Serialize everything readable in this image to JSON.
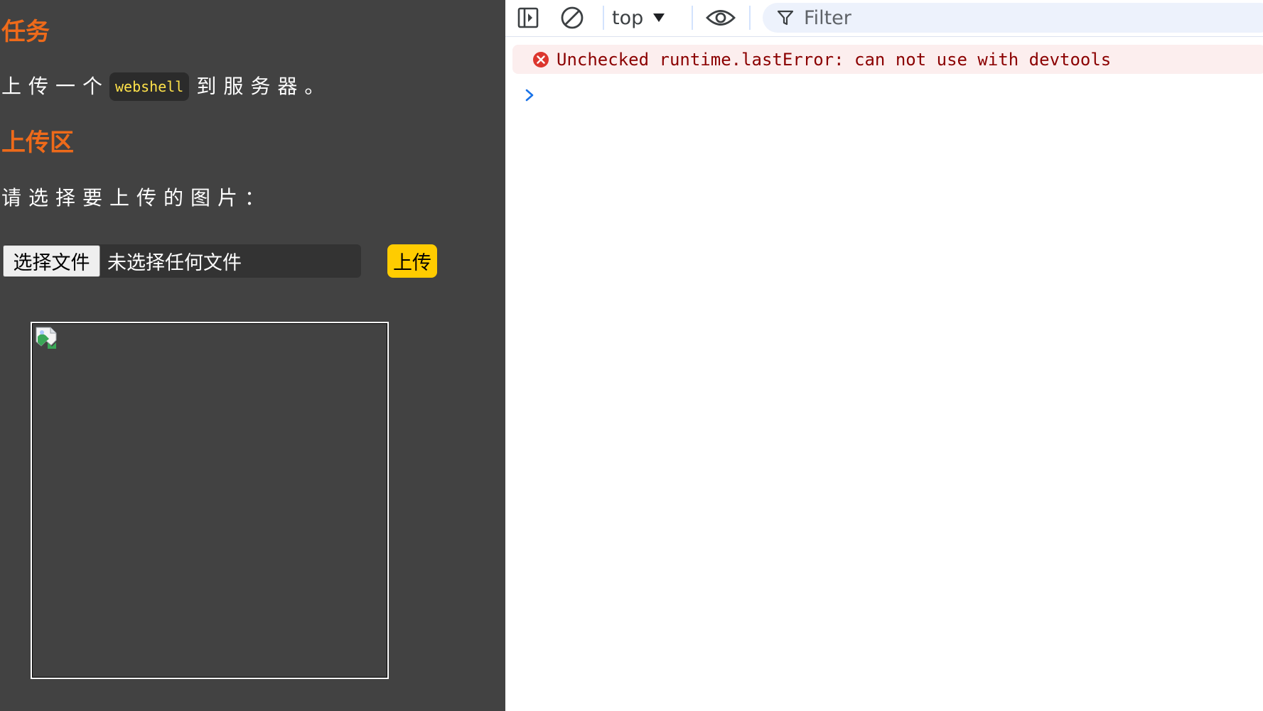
{
  "page": {
    "task_heading": "任务",
    "task_text_before": "上传一个",
    "task_code": "webshell",
    "task_text_after": "到服务器。",
    "upload_heading": "上传区",
    "choose_prompt": "请选择要上传的图片：",
    "file_button_label": "选择文件",
    "file_status": "未选择任何文件",
    "upload_button_label": "上传",
    "broken_image_icon": "broken-image-icon"
  },
  "devtools": {
    "toolbar": {
      "sidebar_icon": "sidebar-toggle-icon",
      "clear_icon": "clear-console-icon",
      "context_label": "top",
      "eye_icon": "live-expression-eye-icon",
      "filter_icon": "filter-funnel-icon",
      "filter_placeholder": "Filter"
    },
    "messages": [
      {
        "level": "error",
        "icon": "error-circle-icon",
        "text": "Unchecked runtime.lastError: can not use with devtools"
      }
    ],
    "prompt_icon": "chevron-right-icon"
  },
  "colors": {
    "page_bg": "#424242",
    "heading": "#ee6a1a",
    "code_text": "#ffe24a",
    "upload_button": "#ffcc00",
    "error_bg": "#fceeee",
    "error_text": "#8b0000",
    "error_icon": "#dc362e",
    "prompt": "#1a73e8"
  }
}
